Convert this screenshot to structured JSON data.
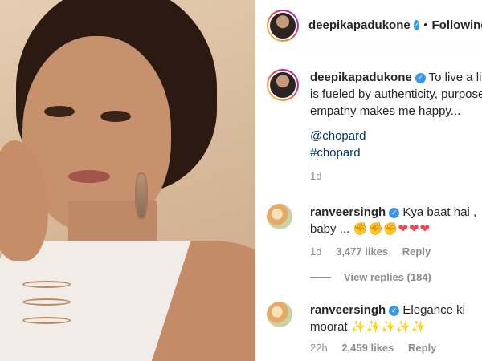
{
  "post": {
    "author": "deepikapadukone",
    "follow_status": "Following",
    "separator": "•"
  },
  "caption": {
    "username": "deepikapadukone",
    "text": "To live a life that is fueled by authenticity, purpose and empathy makes me happy...",
    "tags": [
      "@chopard",
      "#chopard"
    ],
    "time": "1d"
  },
  "comments": [
    {
      "username": "ranveersingh",
      "text": "Kya baat hai , baby ...",
      "emojis": "✊✊✊",
      "hearts": "❤❤❤",
      "time": "1d",
      "likes": "3,477 likes",
      "reply": "Reply"
    },
    {
      "username": "ranveersingh",
      "text": "Elegance ki moorat",
      "emojis": "✨✨✨✨✨",
      "time": "22h",
      "likes": "2,459 likes",
      "reply": "Reply"
    }
  ],
  "view_replies": "View replies (184)",
  "icons": {
    "verified": "verified-badge-icon"
  },
  "colors": {
    "link": "#00376b",
    "verified": "#3897f0",
    "muted": "#8e8e8e",
    "heart": "#ed4956"
  }
}
